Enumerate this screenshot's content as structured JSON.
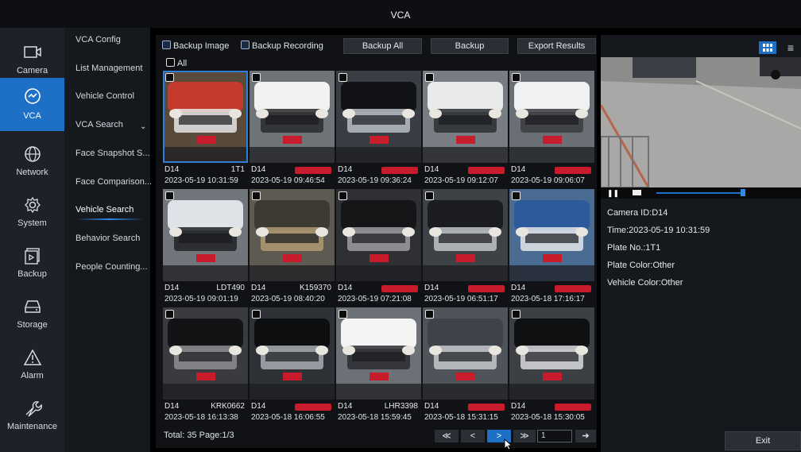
{
  "window": {
    "title": "VCA"
  },
  "nav": {
    "items": [
      {
        "label": "Camera",
        "icon": "camera-icon",
        "active": false
      },
      {
        "label": "VCA",
        "icon": "vca-icon",
        "active": true
      },
      {
        "label": "Network",
        "icon": "globe-icon",
        "active": false
      },
      {
        "label": "System",
        "icon": "gear-icon",
        "active": false
      },
      {
        "label": "Backup",
        "icon": "backup-icon",
        "active": false
      },
      {
        "label": "Storage",
        "icon": "storage-icon",
        "active": false
      },
      {
        "label": "Alarm",
        "icon": "alarm-icon",
        "active": false
      },
      {
        "label": "Maintenance",
        "icon": "wrench-icon",
        "active": false
      }
    ]
  },
  "subnav": {
    "items": [
      {
        "label": "VCA Config"
      },
      {
        "label": "List Management"
      },
      {
        "label": "Vehicle Control"
      },
      {
        "label": "VCA Search"
      },
      {
        "label": "Face Snapshot S..."
      },
      {
        "label": "Face Comparison..."
      },
      {
        "label": "Vehicle Search"
      },
      {
        "label": "Behavior Search"
      },
      {
        "label": "People Counting..."
      }
    ]
  },
  "toolbar": {
    "backup_image": "Backup Image",
    "backup_recording": "Backup Recording",
    "backup_all": "Backup All",
    "backup": "Backup",
    "export_results": "Export Results",
    "select_all": "All"
  },
  "results": [
    {
      "camera": "D14",
      "plate": "1T1",
      "time": "2023-05-19 10:31:59",
      "redacted": false,
      "selected": true
    },
    {
      "camera": "D14",
      "plate": "",
      "time": "2023-05-19 09:46:54",
      "redacted": true,
      "selected": false
    },
    {
      "camera": "D14",
      "plate": "",
      "time": "2023-05-19 09:36:24",
      "redacted": true,
      "selected": false
    },
    {
      "camera": "D14",
      "plate": "",
      "time": "2023-05-19 09:12:07",
      "redacted": true,
      "selected": false
    },
    {
      "camera": "D14",
      "plate": "",
      "time": "2023-05-19 09:06:07",
      "redacted": true,
      "selected": false
    },
    {
      "camera": "D14",
      "plate": "LDT490",
      "time": "2023-05-19 09:01:19",
      "redacted": false,
      "selected": false
    },
    {
      "camera": "D14",
      "plate": "K159370",
      "time": "2023-05-19 08:40:20",
      "redacted": false,
      "selected": false
    },
    {
      "camera": "D14",
      "plate": "",
      "time": "2023-05-19 07:21:08",
      "redacted": true,
      "selected": false
    },
    {
      "camera": "D14",
      "plate": "",
      "time": "2023-05-19 06:51:17",
      "redacted": true,
      "selected": false
    },
    {
      "camera": "D14",
      "plate": "",
      "time": "2023-05-18 17:16:17",
      "redacted": true,
      "selected": false
    },
    {
      "camera": "D14",
      "plate": "KRK0662",
      "time": "2023-05-18 16:13:38",
      "redacted": false,
      "selected": false
    },
    {
      "camera": "D14",
      "plate": "",
      "time": "2023-05-18 16:06:55",
      "redacted": true,
      "selected": false
    },
    {
      "camera": "D14",
      "plate": "LHR3398",
      "time": "2023-05-18 15:59:45",
      "redacted": false,
      "selected": false
    },
    {
      "camera": "D14",
      "plate": "",
      "time": "2023-05-18 15:31:15",
      "redacted": true,
      "selected": false
    },
    {
      "camera": "D14",
      "plate": "",
      "time": "2023-05-18 15:30:05",
      "redacted": true,
      "selected": false
    }
  ],
  "pagination": {
    "summary": "Total: 35  Page:1/3",
    "first": "≪",
    "prev": "<",
    "next": ">",
    "last": "≫",
    "page_input": "1",
    "go": "➔"
  },
  "detail": {
    "camera_id": "Camera ID:D14",
    "time": "Time:2023-05-19 10:31:59",
    "plate_no": "Plate No.:1T1",
    "plate_color": "Plate Color:Other",
    "vehicle_color": "Vehicle Color:Other"
  },
  "exit_label": "Exit",
  "colors": {
    "accent": "#1e6fc6",
    "redaction": "#c81b2b"
  }
}
